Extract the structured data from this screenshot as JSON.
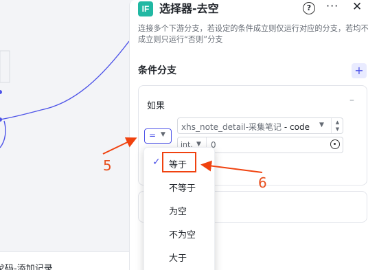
{
  "node_title": "选择器-去空",
  "node_badge": "IF",
  "node_desc": "连接多个下游分支，若设定的条件成立则仅运行对应的分支，若均不成立则只运行“否则”分支",
  "canvas": {
    "bottom_node_label": "戈码-添加记录"
  },
  "section": {
    "title": "条件分支",
    "add_label": "+"
  },
  "branch": {
    "if_label": "如果",
    "collapse_label": "–",
    "operator_selected": "=",
    "left_source": "xhs_note_detail-采集笔记",
    "left_sep": " - ",
    "left_field": "code",
    "right_type": "int.",
    "right_value": "0"
  },
  "operator_options": [
    {
      "label": "等于",
      "selected": true
    },
    {
      "label": "不等于",
      "selected": false
    },
    {
      "label": "为空",
      "selected": false
    },
    {
      "label": "不为空",
      "selected": false
    },
    {
      "label": "大于",
      "selected": false
    }
  ],
  "annotations": {
    "step_5": "5",
    "step_6": "6"
  },
  "colors": {
    "accent": "#4d53e8",
    "badge": "#21b8a3",
    "annotation": "#f0420f"
  }
}
